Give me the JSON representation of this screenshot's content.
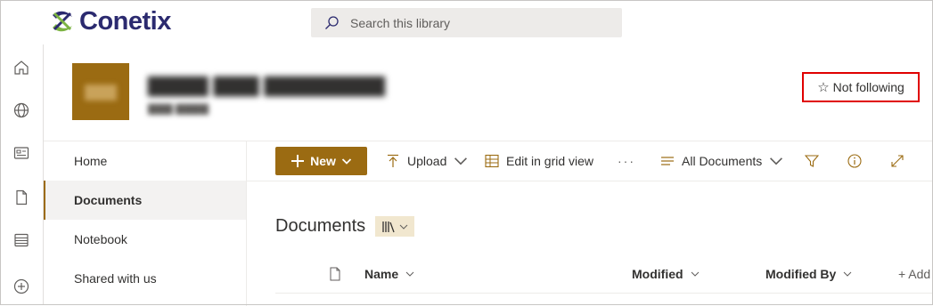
{
  "brand": {
    "name": "Conetix"
  },
  "search": {
    "placeholder": "Search this library"
  },
  "rail": {
    "items": [
      "home-icon",
      "globe-icon",
      "news-icon",
      "file-icon",
      "list-icon",
      "add-circle-icon"
    ]
  },
  "site": {
    "follow_label": "Not following"
  },
  "nav": {
    "items": [
      {
        "label": "Home"
      },
      {
        "label": "Documents",
        "selected": true
      },
      {
        "label": "Notebook"
      },
      {
        "label": "Shared with us"
      }
    ]
  },
  "commands": {
    "new_label": "New",
    "upload_label": "Upload",
    "grid_label": "Edit in grid view",
    "more_label": "···",
    "view_label": "All Documents"
  },
  "library": {
    "title": "Documents"
  },
  "columns": {
    "name": "Name",
    "modified": "Modified",
    "modified_by": "Modified By",
    "add_column": "+ Add"
  },
  "colors": {
    "accent": "#9b6b12",
    "highlight": "#e00000",
    "brand": "#2b2a6f"
  }
}
